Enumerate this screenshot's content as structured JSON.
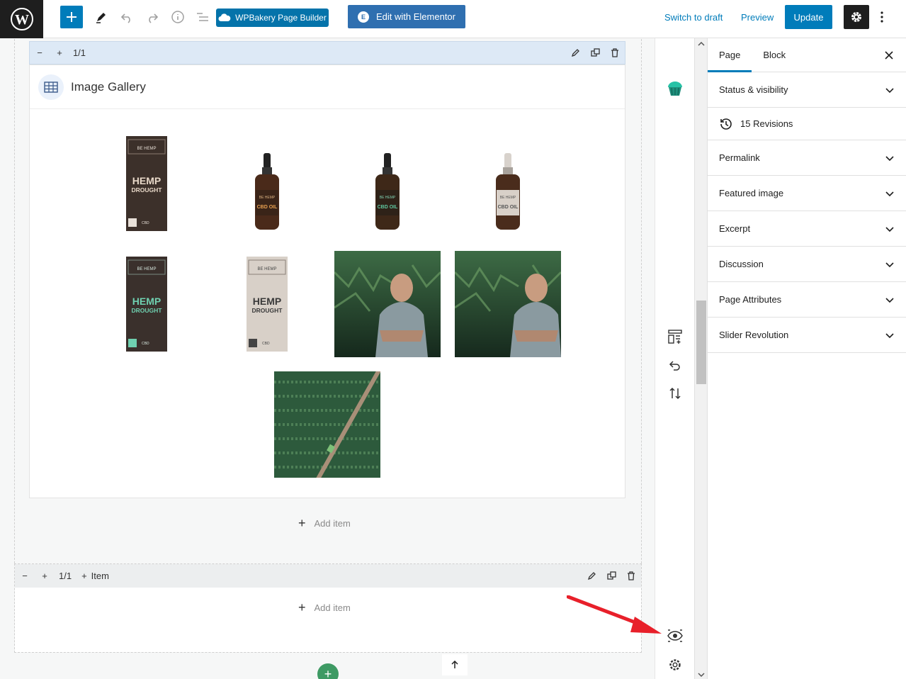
{
  "toolbar": {
    "wpb_label": "WPBakery Page Builder",
    "elementor_label": "Edit with Elementor",
    "switch_draft": "Switch to draft",
    "preview": "Preview",
    "update": "Update"
  },
  "element_toolbar": {
    "minus": "−",
    "plus": "+",
    "width": "1/1"
  },
  "gallery": {
    "title": "Image Gallery",
    "product_text": {
      "brand": "BE HEMP",
      "drought_line1": "HEMP",
      "drought_line2": "DROUGHT",
      "oil": "CBD OIL",
      "cbd": "CBD"
    }
  },
  "add_item_label": "Add item",
  "row2_toolbar": {
    "minus": "−",
    "plus": "+",
    "width": "1/1",
    "item": "Item"
  },
  "sidebar": {
    "tabs": [
      "Page",
      "Block"
    ],
    "panels": [
      "Status & visibility",
      "Permalink",
      "Featured image",
      "Excerpt",
      "Discussion",
      "Page Attributes",
      "Slider Revolution"
    ],
    "revisions": "15 Revisions"
  },
  "colors": {
    "accent": "#007cba",
    "wpbakery": "#0473aa",
    "elementor": "#2f6fb0",
    "annotation_arrow": "#e8202a",
    "row_toolbar": "#dde9f6"
  }
}
